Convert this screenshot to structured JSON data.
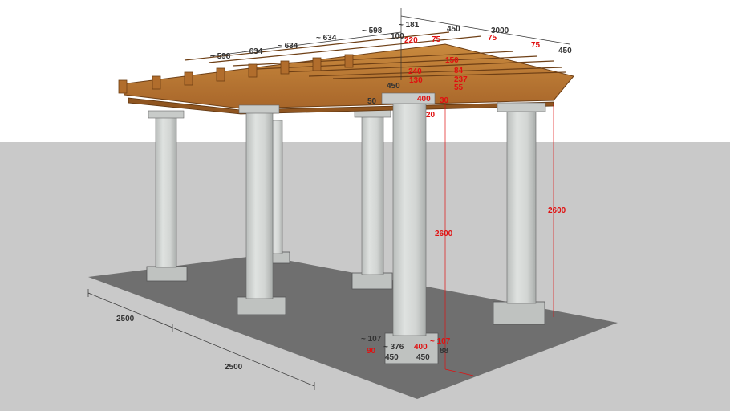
{
  "colors": {
    "sky": "#ffffff",
    "ground": "#c9c9c9",
    "slab": "#6f6f6f",
    "column": "#cfd3d1",
    "wood": "#b8742f",
    "dim_black": "#333333",
    "dim_red": "#e01010"
  },
  "dimensions": {
    "width_front": "2500",
    "width_side": "2500",
    "col_height_a": "2600",
    "col_height_b": "2600",
    "top_181": "~ 181",
    "top_100": "100",
    "top_220": "220",
    "top_75a": "75",
    "top_450a": "450",
    "top_3000": "3000",
    "top_75b": "75",
    "top_75c": "75",
    "top_450b": "450",
    "sp_598a": "~ 598",
    "sp_634a": "~ 634",
    "sp_634b": "~ 634",
    "sp_634c": "~ 634",
    "sp_598b": "~ 598",
    "cap_450": "450",
    "cap_150": "150",
    "cap_240": "240",
    "cap_50": "50",
    "cap_400": "400",
    "cap_30": "30",
    "cap_20": "20",
    "r_130": "130",
    "r_84": "84",
    "r_237": "237",
    "r_55": "55",
    "b_107a": "~ 107",
    "b_376": "~ 376",
    "b_400": "400",
    "b_107b": "~ 107",
    "b_90": "90",
    "b_450a": "450",
    "b_450b": "450",
    "b_88": "88"
  }
}
